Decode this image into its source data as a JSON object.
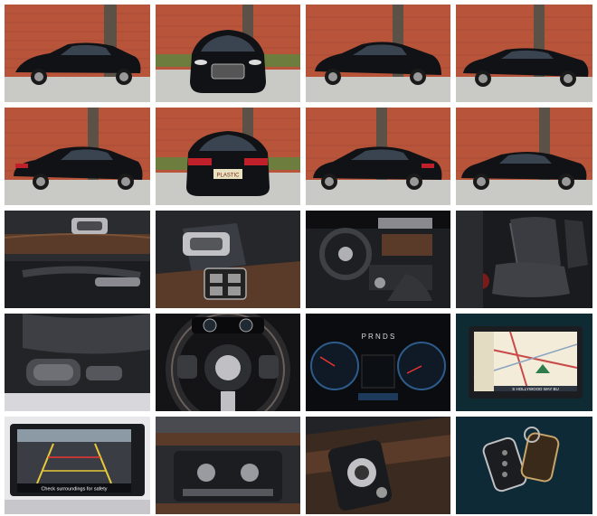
{
  "gallery": {
    "tiles": [
      {
        "subject": "exterior-front-three-quarter-left"
      },
      {
        "subject": "exterior-front"
      },
      {
        "subject": "exterior-front-three-quarter-right"
      },
      {
        "subject": "exterior-side-right"
      },
      {
        "subject": "exterior-rear-three-quarter-left"
      },
      {
        "subject": "exterior-rear"
      },
      {
        "subject": "exterior-rear-three-quarter-right"
      },
      {
        "subject": "exterior-side-left"
      },
      {
        "subject": "interior-door-panel"
      },
      {
        "subject": "interior-door-switches"
      },
      {
        "subject": "interior-dashboard"
      },
      {
        "subject": "interior-front-seats"
      },
      {
        "subject": "interior-seat-controls"
      },
      {
        "subject": "interior-steering-wheel"
      },
      {
        "subject": "interior-instrument-cluster"
      },
      {
        "subject": "interior-navigation-screen"
      },
      {
        "subject": "interior-backup-camera"
      },
      {
        "subject": "interior-climate-controls"
      },
      {
        "subject": "interior-gear-selector"
      },
      {
        "subject": "key-fob"
      }
    ]
  },
  "screens": {
    "camera_caption": "Check surroundings for safety",
    "nav_street": "S HOLLYWOOD WAY BU",
    "gear_letters": "P R N D S",
    "rear_plate": "PLASTIC"
  },
  "colors": {
    "brick": "#b8543a",
    "car_body": "#101216",
    "pavement": "#c9c9c6",
    "interior": "#2a2c30",
    "wood": "#5a3a28"
  }
}
